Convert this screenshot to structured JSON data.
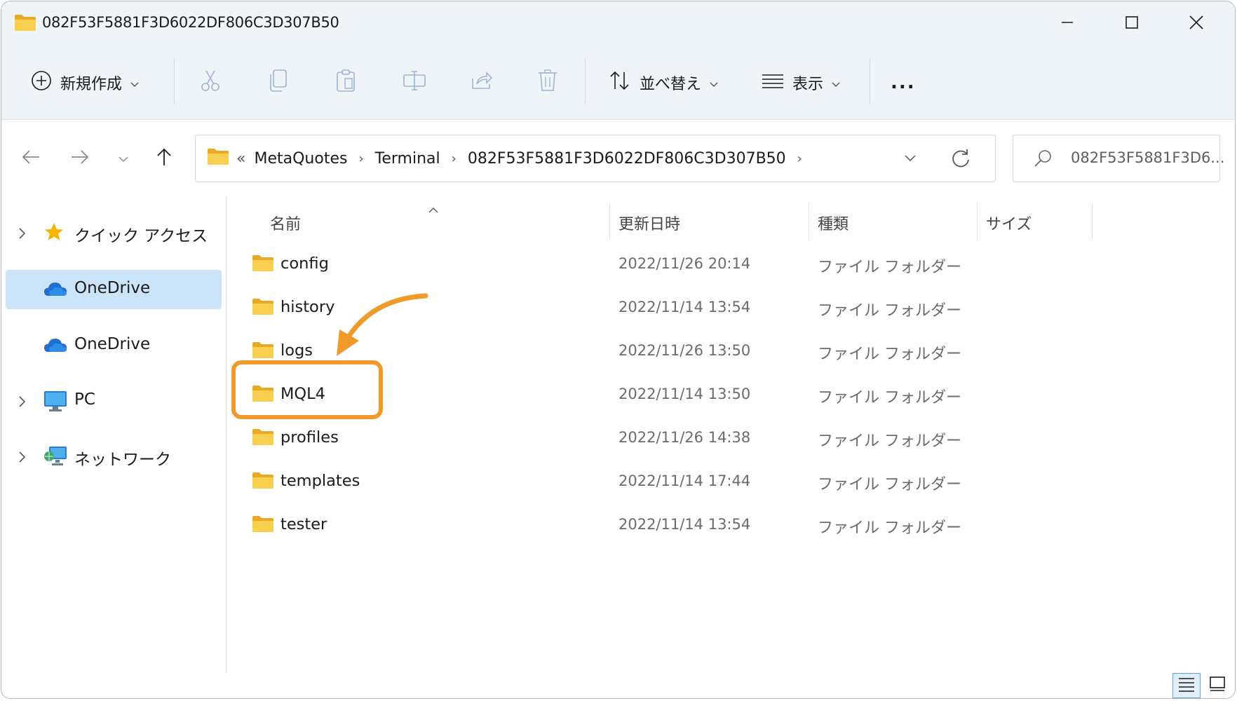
{
  "window": {
    "title": "082F53F5881F3D6022DF806C3D307B50"
  },
  "toolbar": {
    "new_label": "新規作成",
    "sort_label": "並べ替え",
    "view_label": "表示",
    "more_label": "..."
  },
  "address": {
    "overflow": "«",
    "crumbs": [
      "MetaQuotes",
      "Terminal",
      "082F53F5881F3D6022DF806C3D307B50"
    ],
    "search_placeholder": "082F53F5881F3D6..."
  },
  "sidebar": {
    "items": [
      {
        "label": "クイック アクセス",
        "icon": "star-icon",
        "expandable": true
      },
      {
        "label": "OneDrive",
        "icon": "onedrive-icon",
        "expandable": false,
        "selected": true
      },
      {
        "label": "OneDrive",
        "icon": "onedrive-icon",
        "expandable": false
      },
      {
        "label": "PC",
        "icon": "pc-icon",
        "expandable": true
      },
      {
        "label": "ネットワーク",
        "icon": "network-icon",
        "expandable": true
      }
    ]
  },
  "columns": {
    "name": "名前",
    "modified": "更新日時",
    "type": "種類",
    "size": "サイズ"
  },
  "files": [
    {
      "name": "config",
      "modified": "2022/11/26 20:14",
      "type": "ファイル フォルダー"
    },
    {
      "name": "history",
      "modified": "2022/11/14 13:54",
      "type": "ファイル フォルダー"
    },
    {
      "name": "logs",
      "modified": "2022/11/26 13:50",
      "type": "ファイル フォルダー"
    },
    {
      "name": "MQL4",
      "modified": "2022/11/14 13:50",
      "type": "ファイル フォルダー"
    },
    {
      "name": "profiles",
      "modified": "2022/11/26 14:38",
      "type": "ファイル フォルダー"
    },
    {
      "name": "templates",
      "modified": "2022/11/14 17:44",
      "type": "ファイル フォルダー"
    },
    {
      "name": "tester",
      "modified": "2022/11/14 13:54",
      "type": "ファイル フォルダー"
    }
  ],
  "colors": {
    "highlight": "#f09a2a",
    "selection": "#cce4f7",
    "folder": "#f6c944"
  }
}
